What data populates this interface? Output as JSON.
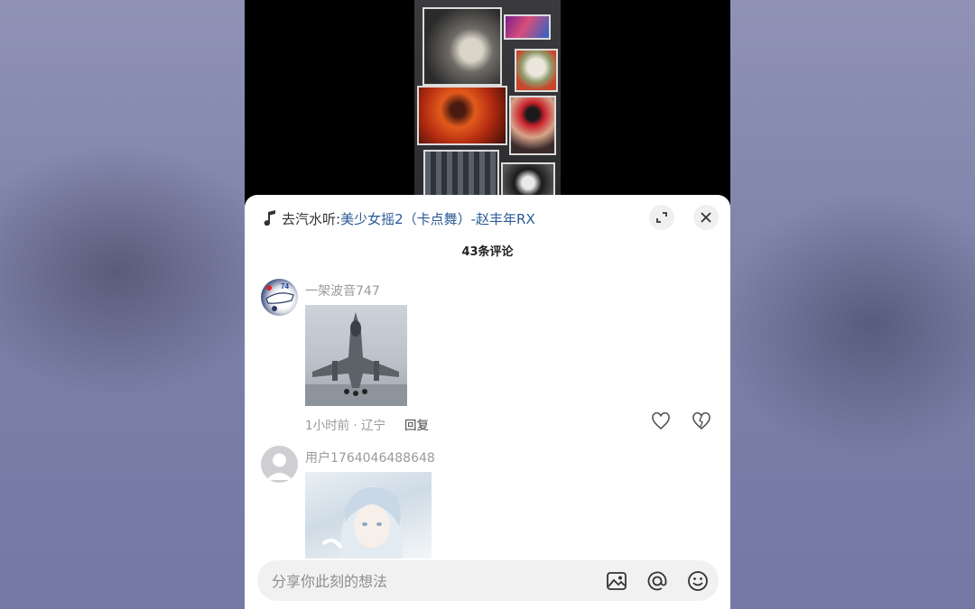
{
  "background_color": "#7d83a8",
  "accent_color": "#2a5a96",
  "music": {
    "prefix": "去汽水听: ",
    "song": "美少女摇2（卡点舞）-赵丰年RX",
    "icon": "music-note-icon"
  },
  "panel": {
    "title": "43条评论",
    "expand_icon": "expand-icon",
    "close_icon": "close-icon"
  },
  "comments": [
    {
      "username": "一架波音747",
      "image_desc": "fighter-jet-photo",
      "meta": "1小时前 · 辽宁",
      "reply_label": "回复",
      "like_icon": "heart-icon",
      "dislike_icon": "broken-heart-icon"
    },
    {
      "username": "用户1764046488648",
      "image_desc": "anime-girl-illustration"
    }
  ],
  "input": {
    "placeholder": "分享你此刻的想法",
    "image_icon": "image-icon",
    "at_icon": "at-icon",
    "emoji_icon": "emoji-icon"
  }
}
